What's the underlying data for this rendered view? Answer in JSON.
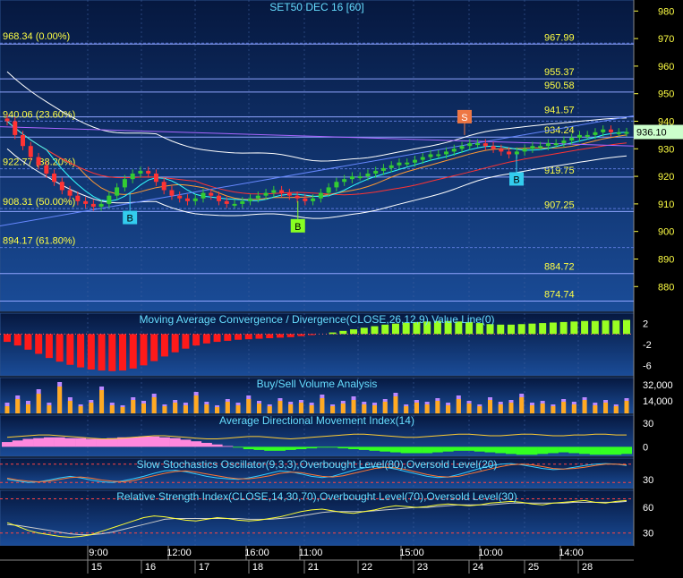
{
  "chart_data": [
    {
      "type": "candlestick",
      "title": "SET50 DEC 16",
      "interval": "[60]",
      "ylim": [
        871,
        984
      ],
      "yticks": [
        "980",
        "970",
        "960",
        "950",
        "940",
        "930",
        "920",
        "910",
        "900",
        "890",
        "880"
      ],
      "current_price": "936.10",
      "price_levels": [
        {
          "price": 967.99,
          "label": "967.99"
        },
        {
          "price": 955.37,
          "label": "955.37"
        },
        {
          "price": 950.58,
          "label": "950.58"
        },
        {
          "price": 941.57,
          "label": "941.57"
        },
        {
          "price": 934.24,
          "label": "934.24"
        },
        {
          "price": 919.75,
          "label": "919.75"
        },
        {
          "price": 907.25,
          "label": "907.25"
        },
        {
          "price": 884.72,
          "label": "884.72"
        },
        {
          "price": 874.74,
          "label": "874.74"
        }
      ],
      "fib_levels": [
        {
          "price": 968.34,
          "label": "968.34 (0.00%)"
        },
        {
          "price": 940.06,
          "label": "940.06 (23.60%)"
        },
        {
          "price": 922.77,
          "label": "922.77 (38.20%)"
        },
        {
          "price": 908.31,
          "label": "908.31 (50.00%)"
        },
        {
          "price": 894.17,
          "label": "894.17 (61.80%)"
        }
      ],
      "signals": [
        {
          "label": "B",
          "x": 0.205,
          "price": 914,
          "color": "#33ccee"
        },
        {
          "label": "B",
          "x": 0.47,
          "price": 911,
          "color": "#88ff22"
        },
        {
          "label": "S",
          "x": 0.733,
          "price": 935,
          "color": "#ee7744"
        },
        {
          "label": "B",
          "x": 0.815,
          "price": 928,
          "color": "#33ccee"
        }
      ],
      "closes": [
        940,
        935,
        931,
        927,
        924,
        921,
        918,
        915,
        913,
        911,
        910,
        909,
        910,
        913,
        916,
        919,
        921,
        922,
        921,
        918,
        915,
        913,
        912,
        911,
        912,
        914,
        913,
        911,
        910,
        910,
        911,
        912,
        913,
        914,
        915,
        914,
        913,
        912,
        911,
        912,
        914,
        916,
        918,
        919,
        920,
        920,
        921,
        922,
        923,
        924,
        925,
        925,
        926,
        927,
        928,
        928,
        929,
        930,
        931,
        932,
        932,
        931,
        930,
        929,
        928,
        929,
        930,
        931,
        931,
        932,
        932,
        933,
        934,
        935,
        935,
        936,
        937,
        936,
        936,
        936.1
      ]
    },
    {
      "type": "area",
      "title": "Moving Average Convergence / Divergence(CLOSE,26,12,9),Value Line(0)",
      "yticks": [
        "2",
        "-2",
        "-6"
      ],
      "ylim": [
        -8,
        4
      ],
      "values": [
        -1.5,
        -2.2,
        -3,
        -3.8,
        -4.6,
        -5.3,
        -5.9,
        -6.4,
        -6.8,
        -7,
        -7.1,
        -7,
        -6.6,
        -6,
        -5.2,
        -4.3,
        -3.5,
        -2.8,
        -2.2,
        -1.8,
        -1.5,
        -1.3,
        -1.1,
        -1,
        -0.9,
        -0.8,
        -0.7,
        -0.6,
        -0.4,
        -0.2,
        0,
        0.3,
        0.6,
        0.9,
        1.2,
        1.5,
        1.8,
        2,
        2.2,
        2.3,
        2.4,
        2.5,
        2.5,
        2.4,
        2.3,
        2.1,
        1.9,
        1.8,
        1.8,
        1.9,
        2,
        2.1,
        2.2,
        2.3,
        2.4,
        2.5,
        2.5,
        2.6,
        2.6,
        2.7
      ]
    },
    {
      "type": "bar",
      "title": "Buy/Sell Volume Analysis",
      "yticks": [
        "32,000",
        "14,000"
      ],
      "ylim": [
        0,
        40000
      ],
      "buy": [
        8000,
        16000,
        10000,
        22000,
        9000,
        30000,
        14000,
        8000,
        12000,
        26000,
        9000,
        7000,
        15000,
        11000,
        18000,
        8000,
        12000,
        9000,
        20000,
        10000,
        7000,
        13000,
        9000,
        16000,
        11000,
        8000,
        14000,
        10000,
        12000,
        9000,
        17000,
        8000,
        11000,
        15000,
        10000,
        9000,
        13000,
        19000,
        8000,
        12000,
        10000,
        14000,
        9000,
        16000,
        11000,
        8000,
        15000,
        10000,
        12000,
        18000,
        9000,
        11000,
        8000,
        13000,
        10000,
        15000,
        9000,
        12000,
        8000,
        14000
      ],
      "sell": [
        12000,
        20000,
        14000,
        27000,
        12000,
        35000,
        18000,
        10000,
        15000,
        30000,
        12000,
        9000,
        18000,
        14000,
        22000,
        10000,
        15000,
        12000,
        24000,
        13000,
        9000,
        16000,
        12000,
        20000,
        14000,
        10000,
        17000,
        13000,
        15000,
        12000,
        21000,
        10000,
        14000,
        19000,
        13000,
        12000,
        16000,
        23000,
        10000,
        15000,
        13000,
        17000,
        12000,
        20000,
        14000,
        10000,
        18000,
        13000,
        15000,
        22000,
        12000,
        14000,
        10000,
        16000,
        13000,
        18000,
        12000,
        15000,
        10000,
        17000
      ]
    },
    {
      "type": "area",
      "title": "Average Directional Movement Index(14)",
      "yticks": [
        "30",
        "0"
      ],
      "ylim": [
        -12,
        40
      ],
      "values": [
        6,
        8,
        10,
        11,
        12,
        12,
        11,
        11,
        10,
        10,
        11,
        12,
        12,
        13,
        13,
        12,
        11,
        9,
        7,
        5,
        3,
        1,
        -1,
        -3,
        -4,
        -5,
        -5,
        -4,
        -3,
        -2,
        -1,
        -1,
        -2,
        -3,
        -4,
        -5,
        -6,
        -7,
        -8,
        -8,
        -8,
        -7,
        -6,
        -5,
        -5,
        -6,
        -7,
        -8,
        -9,
        -10,
        -10,
        -9,
        -8,
        -7,
        -8,
        -9,
        -10,
        -10,
        -10,
        -9
      ],
      "adx": [
        12,
        13,
        14,
        15,
        15,
        14,
        13,
        12,
        11,
        10,
        10,
        11,
        12,
        13,
        14,
        14,
        13,
        12,
        11,
        10,
        10,
        11,
        12,
        13,
        13,
        12,
        11,
        10,
        11,
        12,
        13,
        14,
        15,
        16,
        16,
        15,
        14,
        13,
        12,
        12,
        13,
        14,
        15,
        16,
        16,
        15,
        14,
        14,
        15,
        16,
        16,
        15,
        14,
        14,
        15,
        15,
        16,
        16,
        15,
        15
      ]
    },
    {
      "type": "line",
      "title": "Slow Stochastics Oscillator(9,3,3),Overbought Level(80),Oversold Level(20)",
      "yticks": [
        "30"
      ],
      "ylim": [
        0,
        100
      ],
      "overbought": 80,
      "oversold": 20,
      "k": [
        30,
        25,
        20,
        22,
        28,
        35,
        40,
        35,
        28,
        22,
        20,
        25,
        32,
        40,
        50,
        58,
        60,
        55,
        48,
        40,
        35,
        32,
        30,
        35,
        42,
        50,
        58,
        55,
        48,
        40,
        36,
        40,
        50,
        60,
        68,
        72,
        70,
        64,
        56,
        48,
        40,
        36,
        38,
        46,
        56,
        66,
        74,
        80,
        82,
        78,
        72,
        66,
        62,
        64,
        70,
        76,
        80,
        82,
        80,
        76
      ],
      "d": [
        34,
        28,
        24,
        22,
        24,
        30,
        36,
        38,
        34,
        28,
        24,
        22,
        26,
        34,
        42,
        50,
        56,
        58,
        54,
        48,
        42,
        36,
        32,
        32,
        36,
        42,
        50,
        54,
        52,
        46,
        40,
        38,
        42,
        50,
        58,
        66,
        70,
        68,
        62,
        54,
        46,
        40,
        38,
        40,
        48,
        56,
        64,
        72,
        78,
        80,
        78,
        72,
        66,
        64,
        66,
        70,
        76,
        80,
        80,
        78
      ]
    },
    {
      "type": "line",
      "title": "Relative Strength Index(CLOSE,14,30,70),Overbought Level(70),Oversold Level(30)",
      "yticks": [
        "60",
        "30"
      ],
      "ylim": [
        15,
        80
      ],
      "overbought": 70,
      "oversold": 30,
      "values": [
        42,
        38,
        33,
        30,
        28,
        26,
        25,
        26,
        28,
        32,
        36,
        40,
        44,
        48,
        50,
        49,
        47,
        45,
        44,
        46,
        48,
        47,
        45,
        44,
        45,
        47,
        49,
        52,
        55,
        57,
        58,
        56,
        54,
        53,
        55,
        57,
        60,
        62,
        61,
        60,
        61,
        63,
        64,
        63,
        62,
        63,
        65,
        66,
        67,
        66,
        64,
        63,
        65,
        66,
        67,
        68,
        66,
        65,
        67,
        68
      ],
      "ma": [
        40,
        39,
        37,
        35,
        33,
        31,
        29,
        28,
        28,
        29,
        31,
        34,
        37,
        40,
        43,
        46,
        47,
        47,
        47,
        47,
        47,
        47,
        47,
        46,
        46,
        46,
        47,
        48,
        50,
        52,
        54,
        55,
        55,
        55,
        55,
        56,
        57,
        58,
        59,
        60,
        60,
        61,
        62,
        63,
        63,
        63,
        63,
        64,
        65,
        65,
        65,
        65,
        65,
        65,
        66,
        66,
        66,
        66,
        66,
        67
      ]
    }
  ],
  "time_axis": {
    "hours": [
      "9:00",
      "12:00",
      "16:00",
      "11:00",
      "15:00",
      "10:00",
      "14:00"
    ],
    "dates": [
      "15",
      "16",
      "17",
      "18",
      "21",
      "22",
      "23",
      "24",
      "25",
      "28"
    ]
  },
  "colors": {
    "background": "#0a2a66",
    "candle_up": "#33cc33",
    "candle_down": "#ff3333",
    "macd_negative": "#ff1a1a",
    "macd_positive": "#99ff22",
    "adx_negative": "#ff88dd",
    "adx_positive": "#33ff22",
    "buy_volume": "#ffaa22",
    "sell_volume": "#bb88ff",
    "level_label": "#ffff44"
  }
}
